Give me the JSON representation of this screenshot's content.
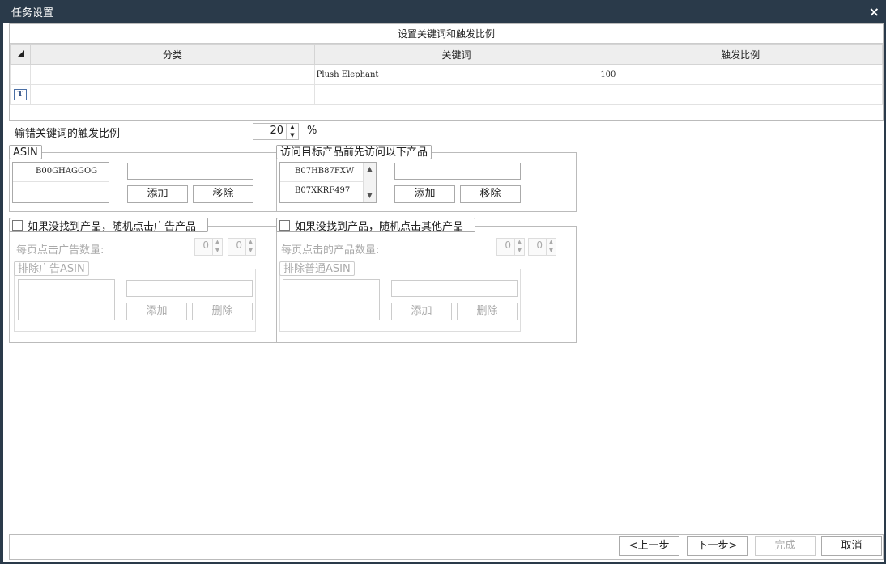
{
  "window": {
    "title": "任务设置",
    "close_icon": "×"
  },
  "keyword_grid": {
    "caption": "设置关键词和触发比例",
    "columns": [
      "分类",
      "关键词",
      "触发比例"
    ],
    "rows": [
      {
        "category": "",
        "keyword": "Plush Elephant",
        "ratio": "100"
      }
    ],
    "new_row_icon": "T"
  },
  "misspell": {
    "label": "输错关键词的触发比例",
    "value": "20",
    "unit": "%"
  },
  "asin_group": {
    "legend": "ASIN",
    "items": [
      "B00GHAGGOG"
    ],
    "input_value": "",
    "add_label": "添加",
    "remove_label": "移除"
  },
  "visit_group": {
    "legend": "访问目标产品前先访问以下产品",
    "items": [
      "B07HB87FXW",
      "B07XKRF497"
    ],
    "input_value": "",
    "add_label": "添加",
    "remove_label": "移除"
  },
  "ad_group": {
    "checkbox_label": "如果没找到产品，随机点击广告产品",
    "checked": false,
    "count_label": "每页点击广告数量:",
    "min_value": "0",
    "max_value": "0",
    "exclude_legend": "排除广告ASIN",
    "add_label": "添加",
    "delete_label": "删除"
  },
  "other_group": {
    "checkbox_label": "如果没找到产品，随机点击其他产品",
    "checked": false,
    "count_label": "每页点击的产品数量:",
    "min_value": "0",
    "max_value": "0",
    "exclude_legend": "排除普通ASIN",
    "add_label": "添加",
    "delete_label": "删除"
  },
  "footer": {
    "prev_label": "<上一步",
    "next_label": "下一步>",
    "finish_label": "完成",
    "cancel_label": "取消"
  },
  "colors": {
    "titlebar": "#2a3a4a",
    "border": "#bbbbbb",
    "disabled_text": "#aaaaaa"
  }
}
